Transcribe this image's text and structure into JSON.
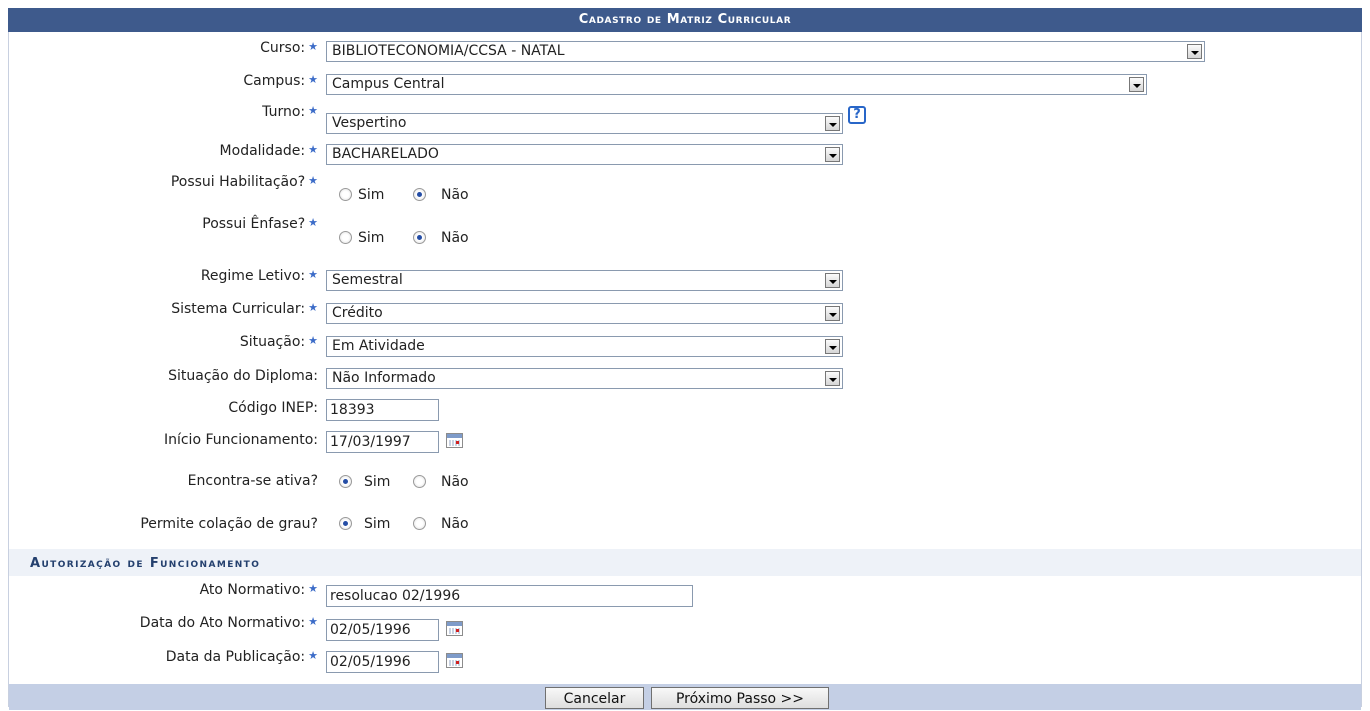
{
  "title": "Cadastro de Matriz Curricular",
  "section_title": "Autorização de Funcionamento",
  "fields": {
    "curso": {
      "label": "Curso:",
      "value": "BIBLIOTECONOMIA/CCSA - NATAL"
    },
    "campus": {
      "label": "Campus:",
      "value": "Campus Central"
    },
    "turno": {
      "label": "Turno:",
      "value": "Vespertino",
      "help": "?"
    },
    "modalidade": {
      "label": "Modalidade:",
      "value": "BACHARELADO"
    },
    "habilitacao": {
      "label": "Possui Habilitação?",
      "yes": "Sim",
      "no": "Não",
      "selected": "Não"
    },
    "enfase": {
      "label": "Possui Ênfase?",
      "yes": "Sim",
      "no": "Não",
      "selected": "Não"
    },
    "regime": {
      "label": "Regime Letivo:",
      "value": "Semestral"
    },
    "sistema": {
      "label": "Sistema Curricular:",
      "value": "Crédito"
    },
    "situacao": {
      "label": "Situação:",
      "value": "Em Atividade"
    },
    "situacao_diploma": {
      "label": "Situação do Diploma:",
      "value": "Não Informado"
    },
    "codigo_inep": {
      "label": "Código INEP:",
      "value": "18393"
    },
    "inicio": {
      "label": "Início Funcionamento:",
      "value": "17/03/1997"
    },
    "ativa": {
      "label": "Encontra-se ativa?",
      "yes": "Sim",
      "no": "Não",
      "selected": "Sim"
    },
    "colacao": {
      "label": "Permite colação de grau?",
      "yes": "Sim",
      "no": "Não",
      "selected": "Sim"
    },
    "ato": {
      "label": "Ato Normativo:",
      "value": "resolucao 02/1996"
    },
    "data_ato": {
      "label": "Data do Ato Normativo:",
      "value": "02/05/1996"
    },
    "data_pub": {
      "label": "Data da Publicação:",
      "value": "02/05/1996"
    }
  },
  "buttons": {
    "cancel": "Cancelar",
    "next": "Próximo Passo >>"
  },
  "colors": {
    "caption_bg": "#3e5a8c",
    "section_bg": "#eef2f8",
    "footer_bg": "#c4cfe5",
    "required_star": "#3c6cc8"
  }
}
